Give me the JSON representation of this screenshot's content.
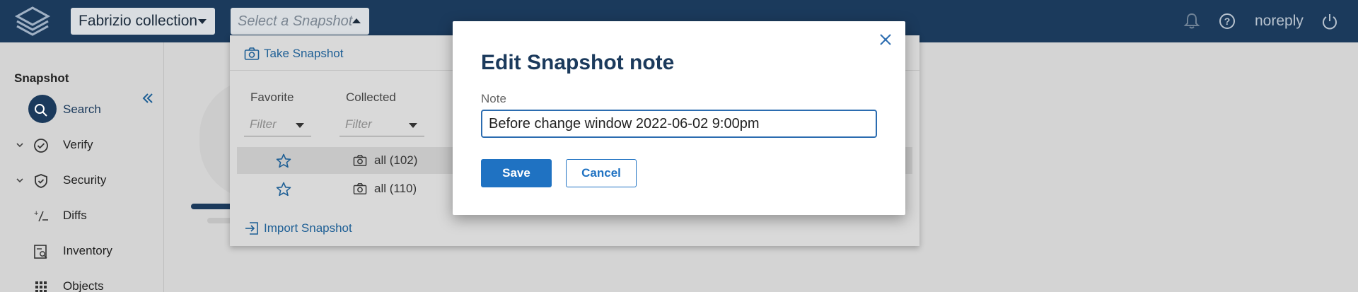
{
  "topbar": {
    "collection_label": "Fabrizio collection",
    "snapshot_placeholder": "Select a Snapshot",
    "username": "noreply"
  },
  "sidebar": {
    "heading": "Snapshot",
    "items": [
      {
        "label": "Search",
        "icon": "search-icon",
        "active": true
      },
      {
        "label": "Verify",
        "icon": "check-circle-icon"
      },
      {
        "label": "Security",
        "icon": "shield-icon"
      },
      {
        "label": "Diffs",
        "icon": "diff-icon"
      },
      {
        "label": "Inventory",
        "icon": "inventory-icon"
      },
      {
        "label": "Objects",
        "icon": "grid-icon"
      }
    ]
  },
  "snapshot_panel": {
    "take_label": "Take Snapshot",
    "columns": [
      "Favorite",
      "Collected"
    ],
    "filter_placeholder": "Filter",
    "rows": [
      {
        "text": "all (102)",
        "selected": true
      },
      {
        "text": "all (110)",
        "selected": false
      }
    ],
    "import_label": "Import Snapshot"
  },
  "modal": {
    "title": "Edit Snapshot note",
    "field_label": "Note",
    "note_value": "Before change window 2022-06-02 9:00pm",
    "save_label": "Save",
    "cancel_label": "Cancel"
  },
  "colors": {
    "topbar": "#1b3a5c",
    "accent": "#1f72c2",
    "link": "#1e5f95"
  }
}
